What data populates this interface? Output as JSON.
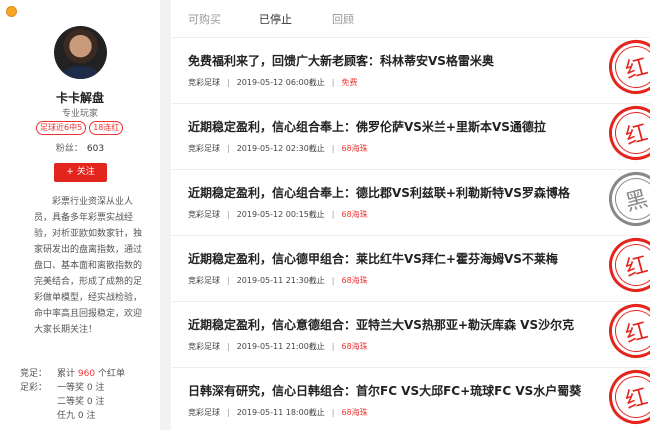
{
  "profile": {
    "name": "卡卡解盘",
    "subtitle": "专业玩家",
    "tags": [
      "足球近6中5",
      "18连红"
    ],
    "fans_label": "粉丝：",
    "fans_count": "603",
    "follow_label": "+ 关注",
    "bio": "彩票行业资深从业人员，具备多年彩票实战经验，对析亚欧如数家针，独家研发出的盘离指数，通过盘口、基本面和离散指数的完美结合，形成了成熟的足彩做单模型，经实战检验，命中率高且回报稳定，欢迎大家长期关注！",
    "stats": [
      {
        "label": "竞足：",
        "prefix": "累计",
        "num": "960",
        "suffix": "个红单"
      },
      {
        "label": "足彩：",
        "prefix": "一等奖",
        "num": "",
        "suffix": "0 注"
      },
      {
        "label": "",
        "prefix": "二等奖",
        "num": "",
        "suffix": "0 注"
      },
      {
        "label": "",
        "prefix": "任九",
        "num": "",
        "suffix": "0 注"
      }
    ]
  },
  "tabs": [
    "可购买",
    "已停止",
    "回顾"
  ],
  "items": [
    {
      "title": "免费福利来了，回馈广大新老顾客：科林蒂安VS格雷米奥",
      "category": "竞彩足球",
      "time": "2019-05-12 06:00截止",
      "price": "免费",
      "result": "红",
      "result_color": "red"
    },
    {
      "title": "近期稳定盈利，信心组合奉上：佛罗伦萨VS米兰+里斯本VS通德拉",
      "category": "竞彩足球",
      "time": "2019-05-12 02:30截止",
      "price": "68海珠",
      "result": "红",
      "result_color": "red"
    },
    {
      "title": "近期稳定盈利，信心组合奉上：德比郡VS利兹联+利勒斯特VS罗森博格",
      "category": "竞彩足球",
      "time": "2019-05-12 00:15截止",
      "price": "68海珠",
      "result": "黑",
      "result_color": "black"
    },
    {
      "title": "近期稳定盈利，信心德甲组合：莱比红牛VS拜仁+霍芬海姆VS不莱梅",
      "category": "竞彩足球",
      "time": "2019-05-11 21:30截止",
      "price": "68海珠",
      "result": "红",
      "result_color": "red"
    },
    {
      "title": "近期稳定盈利，信心意德组合：亚特兰大VS热那亚+勒沃库森 VS沙尔克",
      "category": "竞彩足球",
      "time": "2019-05-11 21:00截止",
      "price": "68海珠",
      "result": "红",
      "result_color": "red"
    },
    {
      "title": "日韩深有研究，信心日韩组合：首尔FC VS大邱FC+琉球FC VS水户蜀葵",
      "category": "竞彩足球",
      "time": "2019-05-11 18:00截止",
      "price": "68海珠",
      "result": "红",
      "result_color": "red"
    }
  ]
}
